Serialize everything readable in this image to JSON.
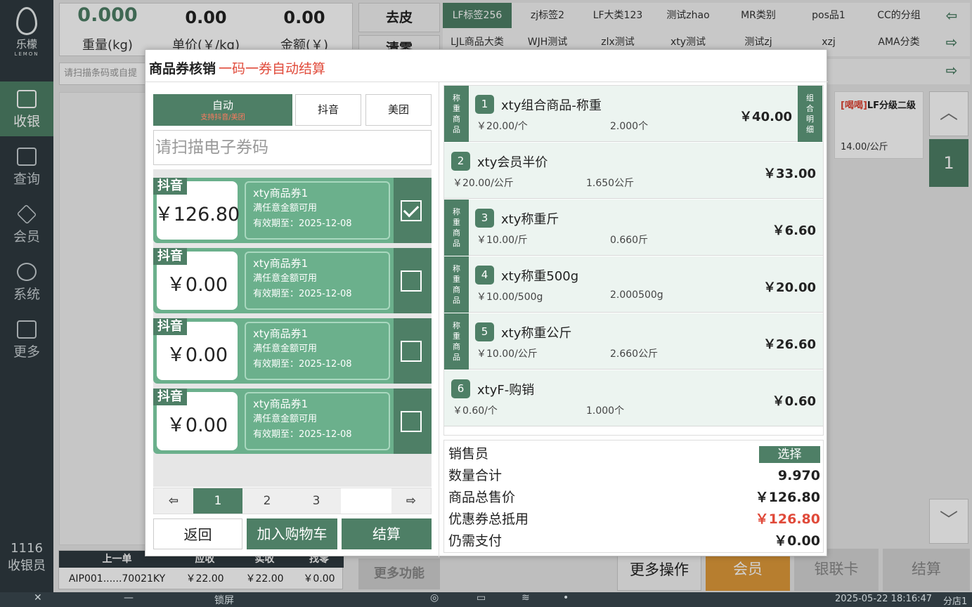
{
  "brand": {
    "name": "乐檬",
    "sub": "LEMON"
  },
  "nav": [
    {
      "label": "收银",
      "icon": "cashier-icon"
    },
    {
      "label": "查询",
      "icon": "search-doc-icon"
    },
    {
      "label": "会员",
      "icon": "diamond-icon"
    },
    {
      "label": "系统",
      "icon": "gear-icon"
    },
    {
      "label": "更多",
      "icon": "grid-icon"
    }
  ],
  "cashier": {
    "id": "1116",
    "role": "收银员"
  },
  "top": {
    "weight": "0.000",
    "weight_label": "重量(kg)",
    "unit_price": "0.00",
    "unit_price_label": "单价(￥/kg)",
    "amount": "0.00",
    "amount_label": "金额(￥)",
    "tare": "去皮",
    "clear": "清零",
    "scan_placeholder": "请扫描条码或自提"
  },
  "category_tabs_row1": [
    "LF标签256",
    "zj标签2",
    "LF大类123",
    "测试zhao",
    "MR类别",
    "pos品1",
    "CC的分组"
  ],
  "category_tabs_row2": [
    "LJL商品大类",
    "WJH测试",
    "zlx测试",
    "xty测试",
    "测试zj",
    "xzj",
    "AMA分类"
  ],
  "product_card": {
    "tag": "[喝喝]",
    "name": "LF分级二级",
    "price": "14.00/公斤"
  },
  "page_indicator": "1",
  "dialog": {
    "title": "商品券核销",
    "subtitle": "一码一券自动结算",
    "modes": [
      {
        "label": "自动",
        "hint": "支持抖音/美团"
      },
      {
        "label": "抖音"
      },
      {
        "label": "美团"
      }
    ],
    "scan_placeholder": "请扫描电子券码",
    "coupons": [
      {
        "platform": "抖音",
        "amount": "￥126.80",
        "name": "xty商品券1",
        "rule": "满任意金额可用",
        "expiry": "有效期至：2025-12-08",
        "checked": true
      },
      {
        "platform": "抖音",
        "amount": "￥0.00",
        "name": "xty商品券1",
        "rule": "满任意金额可用",
        "expiry": "有效期至：2025-12-08",
        "checked": false
      },
      {
        "platform": "抖音",
        "amount": "￥0.00",
        "name": "xty商品券1",
        "rule": "满任意金额可用",
        "expiry": "有效期至：2025-12-08",
        "checked": false
      },
      {
        "platform": "抖音",
        "amount": "￥0.00",
        "name": "xty商品券1",
        "rule": "满任意金额可用",
        "expiry": "有效期至：2025-12-08",
        "checked": false
      }
    ],
    "pages": [
      "1",
      "2",
      "3"
    ],
    "back": "返回",
    "add_cart": "加入购物车",
    "checkout": "结算",
    "weigh_tag": "称重商品",
    "combo_tag": "组合明细",
    "items": [
      {
        "no": "1",
        "name": "xty组合商品-称重",
        "price": "￥20.00/个",
        "qty": "2.000个",
        "total": "￥40.00",
        "weighed": true,
        "combo": true
      },
      {
        "no": "2",
        "name": "xty会员半价",
        "price": "￥20.00/公斤",
        "qty": "1.650公斤",
        "total": "￥33.00",
        "weighed": false,
        "combo": false
      },
      {
        "no": "3",
        "name": "xty称重斤",
        "price": "￥10.00/斤",
        "qty": "0.660斤",
        "total": "￥6.60",
        "weighed": true,
        "combo": false
      },
      {
        "no": "4",
        "name": "xty称重500g",
        "price": "￥10.00/500g",
        "qty": "2.000500g",
        "total": "￥20.00",
        "weighed": true,
        "combo": false
      },
      {
        "no": "5",
        "name": "xty称重公斤",
        "price": "￥10.00/公斤",
        "qty": "2.660公斤",
        "total": "￥26.60",
        "weighed": true,
        "combo": false
      },
      {
        "no": "6",
        "name": "xtyF-购销",
        "price": "￥0.60/个",
        "qty": "1.000个",
        "total": "￥0.60",
        "weighed": false,
        "combo": false
      }
    ],
    "summary": {
      "salesperson_label": "销售员",
      "select": "选择",
      "qty_label": "数量合计",
      "qty": "9.970",
      "total_label": "商品总售价",
      "total": "￥126.80",
      "coupon_label": "优惠券总抵用",
      "coupon": "￥126.80",
      "due_label": "仍需支付",
      "due": "￥0.00"
    }
  },
  "last_order": {
    "headers": [
      "上一单",
      "应收",
      "实收",
      "找零"
    ],
    "values": [
      "AIP001......70021KY",
      "￥22.00",
      "￥22.00",
      "￥0.00"
    ]
  },
  "bottom_buttons": {
    "more_func": "更多功能",
    "more_ops": "更多操作",
    "member": "会员",
    "unionpay": "银联卡",
    "checkout": "结算"
  },
  "statusbar": {
    "lock": "锁屏",
    "datetime": "2025-05-22 18:16:47",
    "store": "分店1"
  },
  "colors": {
    "primary": "#4e7f66",
    "light": "#6bb08c",
    "accent": "#e04a3a",
    "orange": "#e09a3a",
    "sidebar": "#2f3a40"
  }
}
